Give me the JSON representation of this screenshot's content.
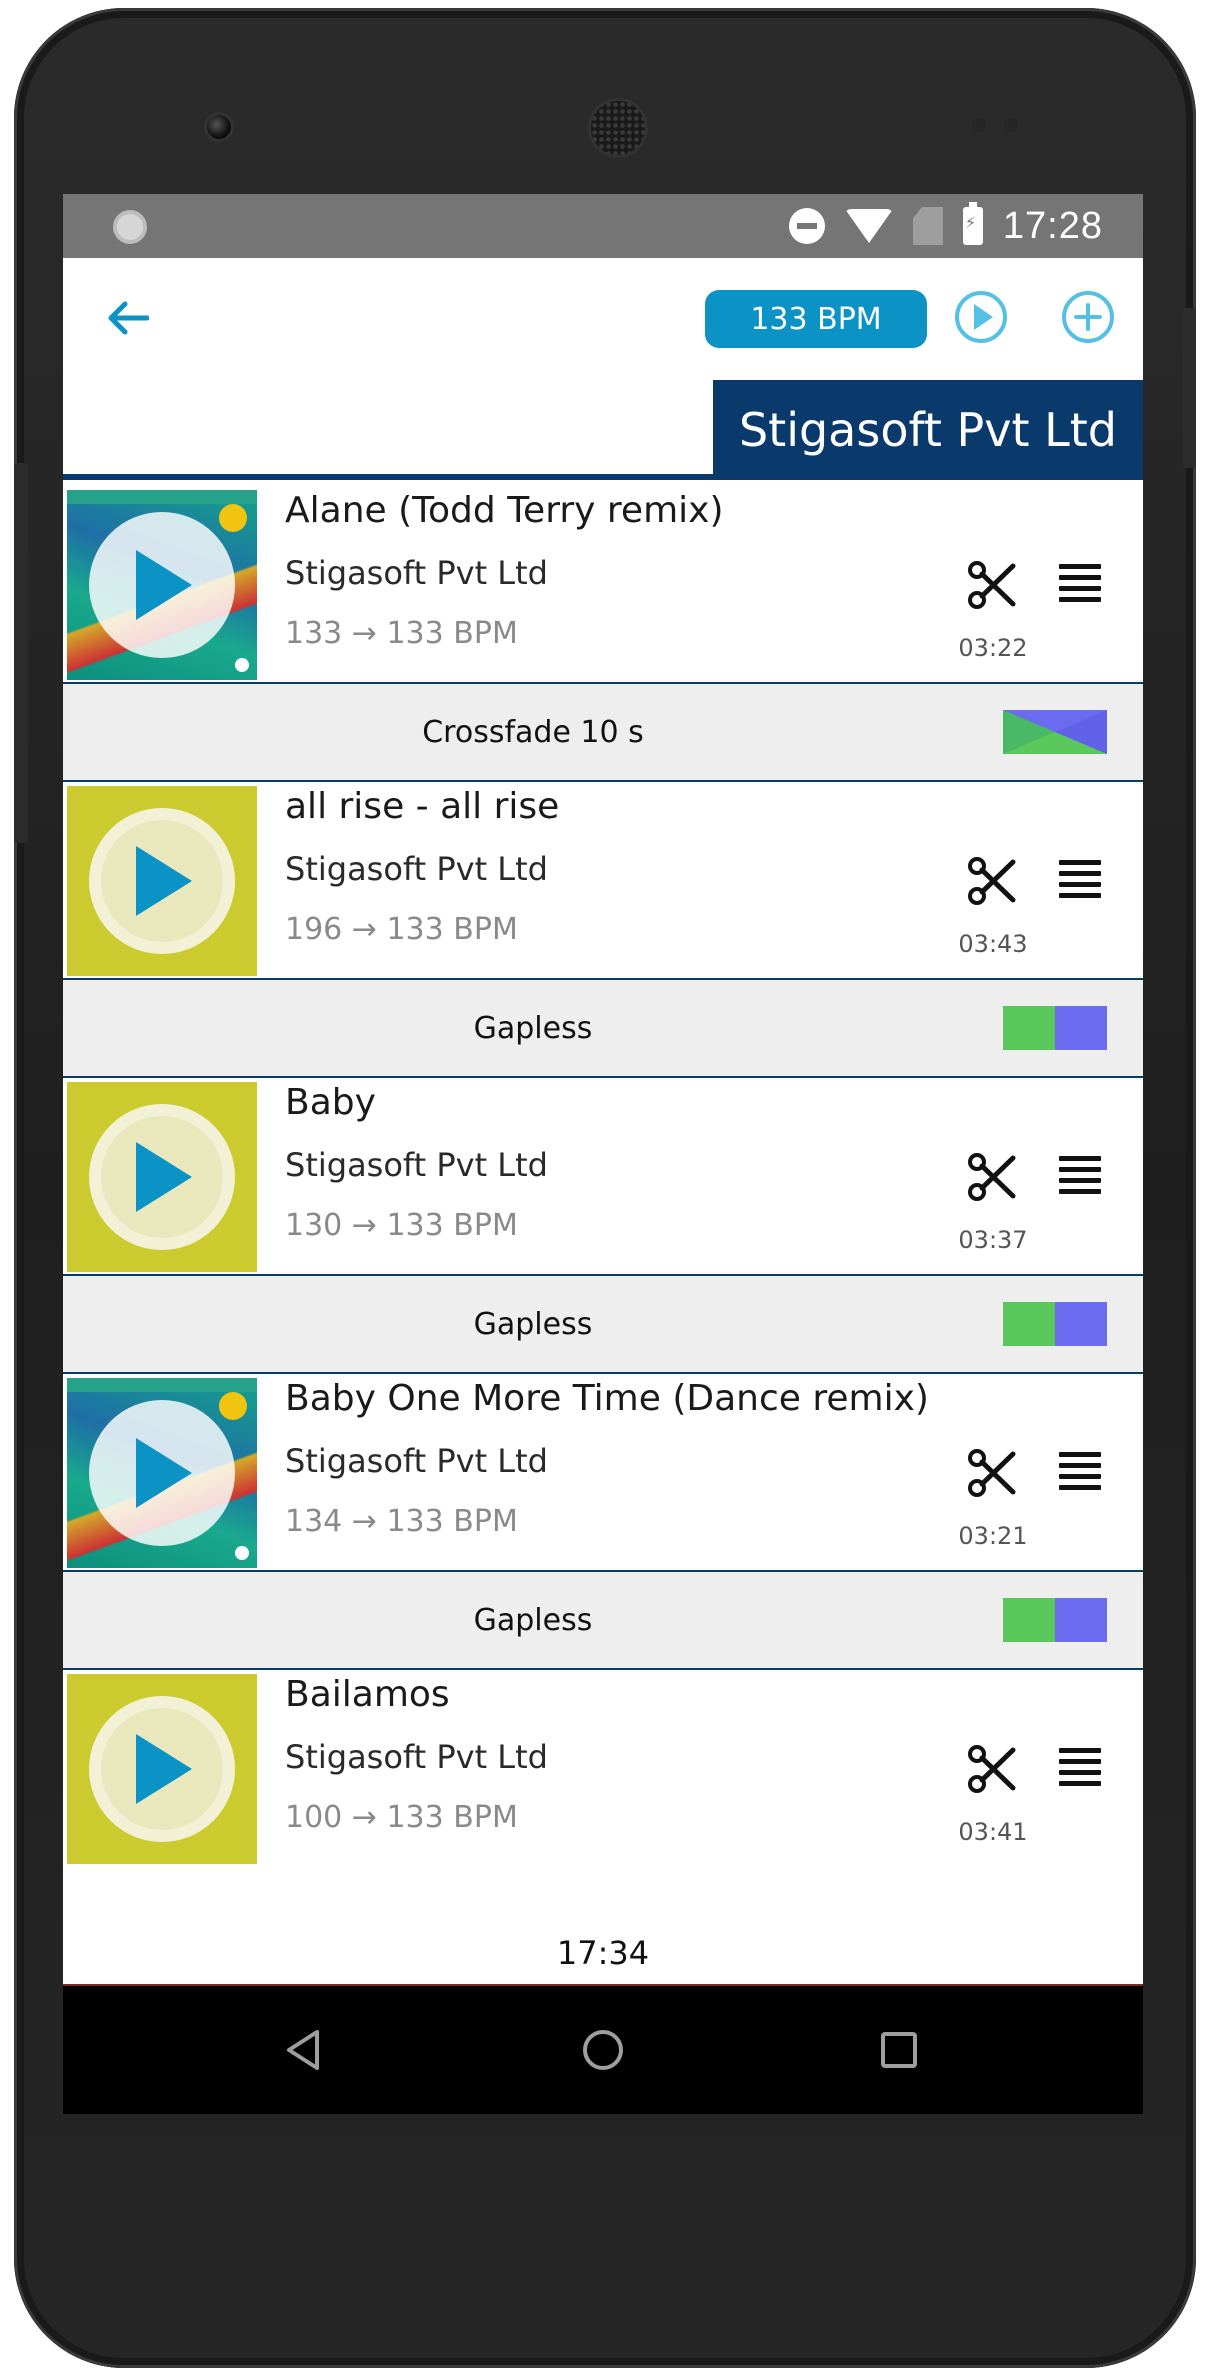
{
  "status_bar": {
    "time": "17:28",
    "icons": [
      "notification-dot-icon",
      "do-not-disturb-icon",
      "wifi-icon",
      "no-sim-icon",
      "battery-charging-icon"
    ]
  },
  "header": {
    "back_icon": "arrow-left-icon",
    "bpm_label": "133 BPM",
    "play_icon": "play-circle-icon",
    "add_icon": "plus-circle-icon",
    "title": "Stigasoft Pvt Ltd"
  },
  "colors": {
    "accent": "#0b93c6",
    "header_dark": "#0a3a6b",
    "thumb_yellow": "#cbca2e",
    "gapless_green": "#5ac85a",
    "gapless_blue": "#6b6bf0"
  },
  "tracks": [
    {
      "title": "Alane (Todd Terry remix)",
      "artist": "Stigasoft Pvt Ltd",
      "bpm": "133 → 133 BPM",
      "duration": "03:22",
      "art": "album"
    },
    {
      "title": "all rise - all rise",
      "artist": "Stigasoft Pvt Ltd",
      "bpm": "196 → 133 BPM",
      "duration": "03:43",
      "art": "yellow"
    },
    {
      "title": "Baby",
      "artist": "Stigasoft Pvt Ltd",
      "bpm": "130 → 133 BPM",
      "duration": "03:37",
      "art": "yellow"
    },
    {
      "title": "Baby One More Time (Dance remix)",
      "artist": "Stigasoft Pvt Ltd",
      "bpm": "134 → 133 BPM",
      "duration": "03:21",
      "art": "album"
    },
    {
      "title": "Bailamos",
      "artist": "Stigasoft Pvt Ltd",
      "bpm": "100 → 133 BPM",
      "duration": "03:41",
      "art": "yellow"
    }
  ],
  "transitions": [
    {
      "label": "Crossfade 10 s",
      "icon": "crossfade-icon"
    },
    {
      "label": "Gapless",
      "icon": "gapless-icon"
    },
    {
      "label": "Gapless",
      "icon": "gapless-icon"
    },
    {
      "label": "Gapless",
      "icon": "gapless-icon"
    }
  ],
  "footer": {
    "end_time": "17:34"
  },
  "nav_bar": {
    "icons": [
      "nav-back-icon",
      "nav-home-icon",
      "nav-recents-icon"
    ]
  }
}
